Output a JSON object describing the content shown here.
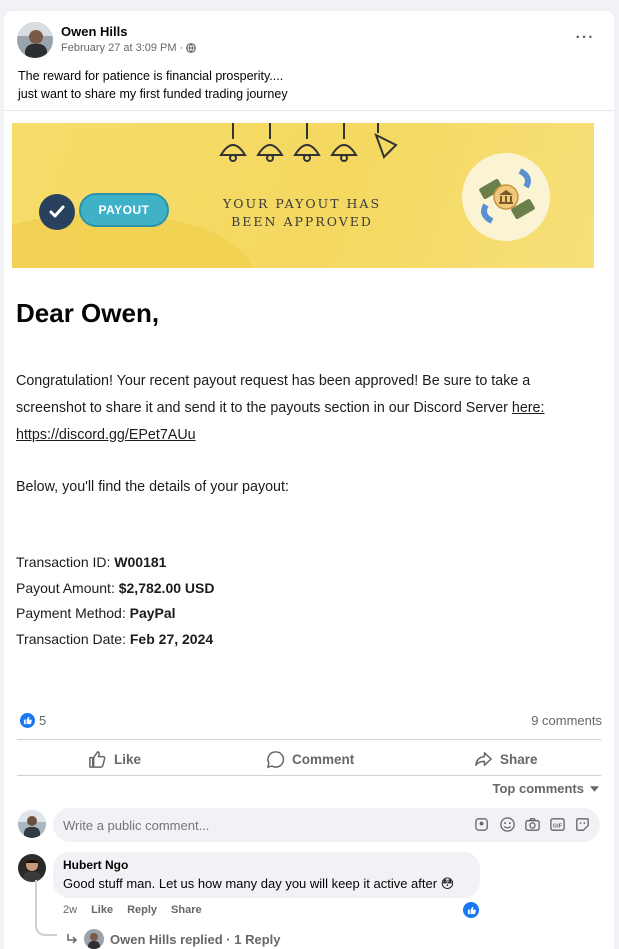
{
  "post": {
    "author": "Owen Hills",
    "timestamp": "February 27 at 3:09 PM ·",
    "text_line1": "The reward for patience is financial prosperity....",
    "text_line2": "just want to share my first funded trading journey",
    "more_label": "···"
  },
  "image": {
    "banner": {
      "pill_label": "PAYOUT",
      "approved_line1": "YOUR PAYOUT HAS",
      "approved_line2": "BEEN APPROVED"
    },
    "greeting": "Dear Owen,",
    "para1_line1": "Congratulation! Your recent payout request has been approved!  Be sure to take a",
    "para1_line2": "screenshot to share it and send it to the payouts section in our Discord Server ",
    "para1_link_here": "here:",
    "para1_link_url": "https://discord.gg/EPet7AUu",
    "para2": "Below, you'll find the details of your payout:",
    "details": [
      {
        "label": "Transaction ID: ",
        "value": "W00181"
      },
      {
        "label": "Payout Amount:  ",
        "value": "$2,782.00 USD"
      },
      {
        "label": "Payment Method: ",
        "value": "PayPal"
      },
      {
        "label": "Transaction Date: ",
        "value": "Feb 27, 2024"
      }
    ]
  },
  "reactions": {
    "like_count": "5",
    "comments_count": "9 comments"
  },
  "actions": {
    "like": "Like",
    "comment": "Comment",
    "share": "Share"
  },
  "top_comments_label": "Top comments",
  "comment_input": {
    "placeholder": "Write a public comment..."
  },
  "comment": {
    "author": "Hubert Ngo",
    "text": "Good stuff man. Let us how many day you will keep it active after 😳",
    "age": "2w",
    "like": "Like",
    "reply": "Reply",
    "share": "Share",
    "replied_text": "Owen Hills replied · 1 Reply"
  },
  "colors": {
    "accent": "#1877f2",
    "banner": "#f4d860",
    "pill": "#3fb2c7"
  }
}
